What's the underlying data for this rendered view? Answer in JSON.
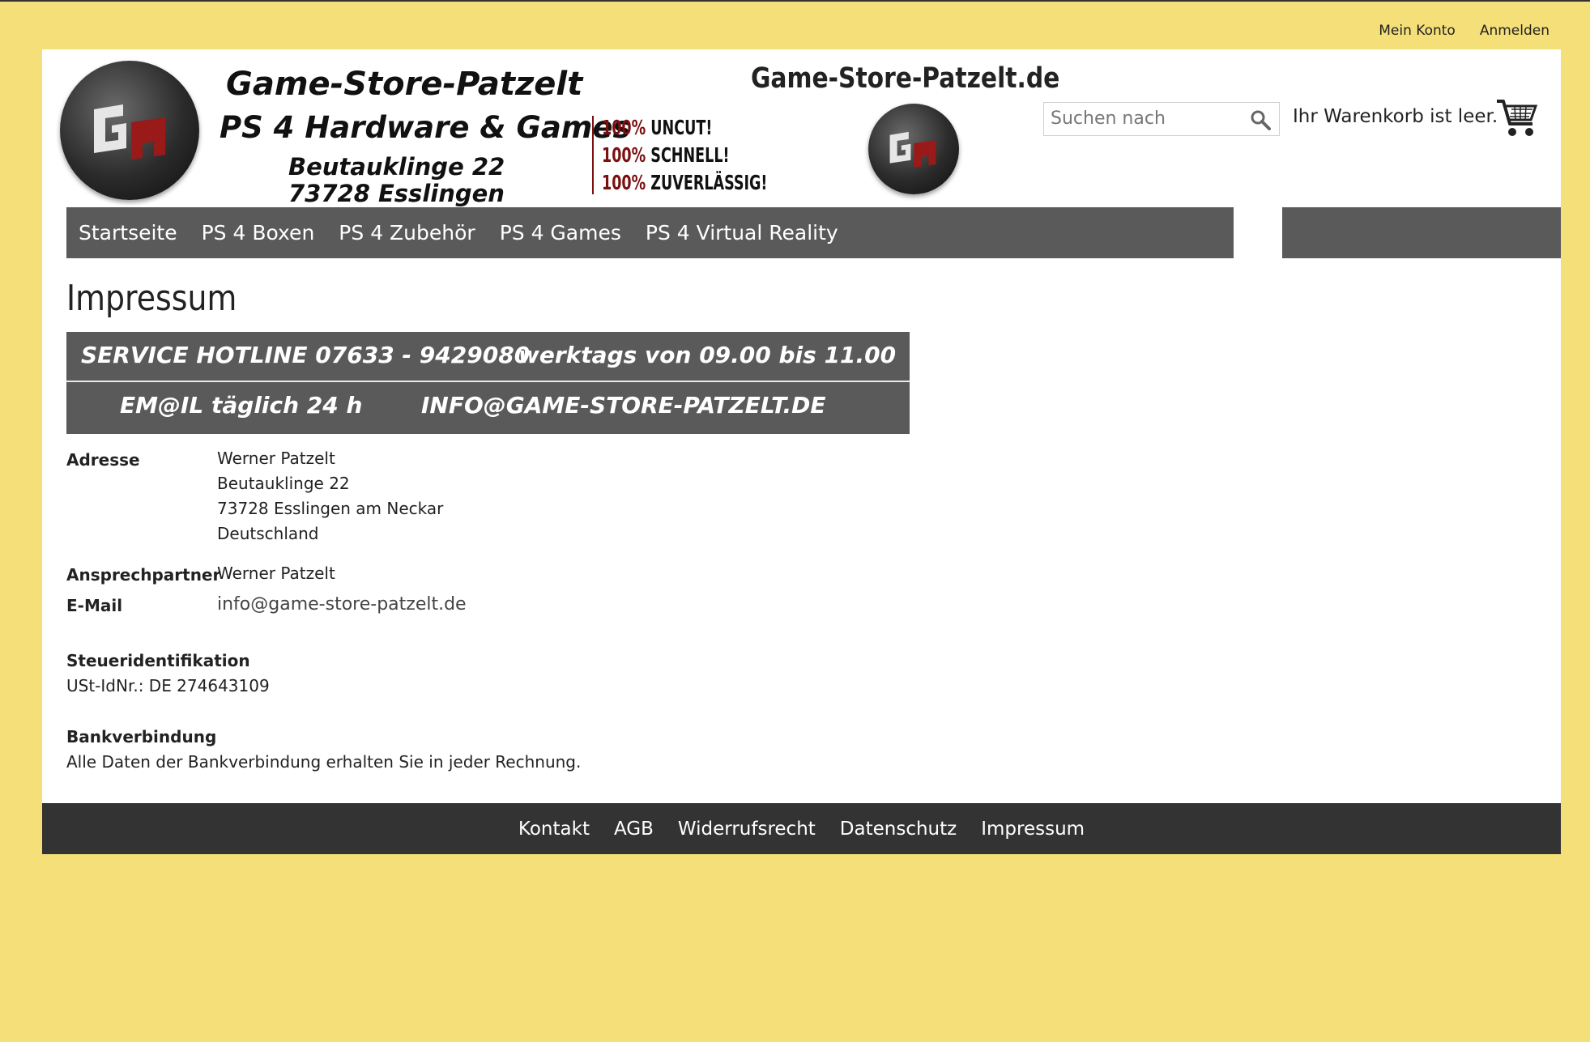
{
  "top_links": {
    "account": "Mein Konto",
    "login": "Anmelden"
  },
  "banner": {
    "store_name": "Game-Store-Patzelt",
    "subtitle": "PS 4 Hardware & Games",
    "street": "Beutauklinge 22",
    "city": "73728 Esslingen",
    "slogans": [
      {
        "pct": "100%",
        "word": "UNCUT!"
      },
      {
        "pct": "100%",
        "word": "SCHNELL!"
      },
      {
        "pct": "100%",
        "word": "ZUVERLÄSSIG!"
      }
    ],
    "domain": "Game-Store-Patzelt.de",
    "accent_color": "#7a1010"
  },
  "search": {
    "placeholder": "Suchen nach",
    "icon": "magnifier-icon"
  },
  "cart": {
    "text": "Ihr Warenkorb ist leer.",
    "icon": "shopping-cart-icon"
  },
  "nav": {
    "items": [
      "Startseite",
      "PS 4 Boxen",
      "PS 4 Zubehör",
      "PS 4 Games",
      "PS 4 Virtual Reality"
    ]
  },
  "page": {
    "title": "Impressum",
    "hotline": {
      "line1a": "SERVICE HOTLINE 07633 - 9429080",
      "line1b": "werktags von 09.00 bis 11.00",
      "line2a": "EM@IL  täglich 24 h",
      "line2b": "INFO@GAME-STORE-PATZELT.DE"
    },
    "address_label": "Adresse",
    "address_lines": [
      "Werner Patzelt",
      "Beutauklinge 22",
      "73728 Esslingen am Neckar",
      "Deutschland"
    ],
    "contact_label": "Ansprechpartner",
    "contact_value": "Werner Patzelt",
    "email_label": "E-Mail",
    "email_value": "info@game-store-patzelt.de",
    "tax_heading": "Steueridentifikation",
    "tax_value": "USt-IdNr.: DE 274643109",
    "bank_heading": "Bankverbindung",
    "bank_value": "Alle Daten der Bankverbindung erhalten Sie in jeder Rechnung."
  },
  "footer": {
    "links": [
      "Kontakt",
      "AGB",
      "Widerrufsrecht",
      "Datenschutz",
      "Impressum"
    ]
  },
  "colors": {
    "background": "#f5df78",
    "nav": "#5a5a5a",
    "footer": "#333333"
  }
}
